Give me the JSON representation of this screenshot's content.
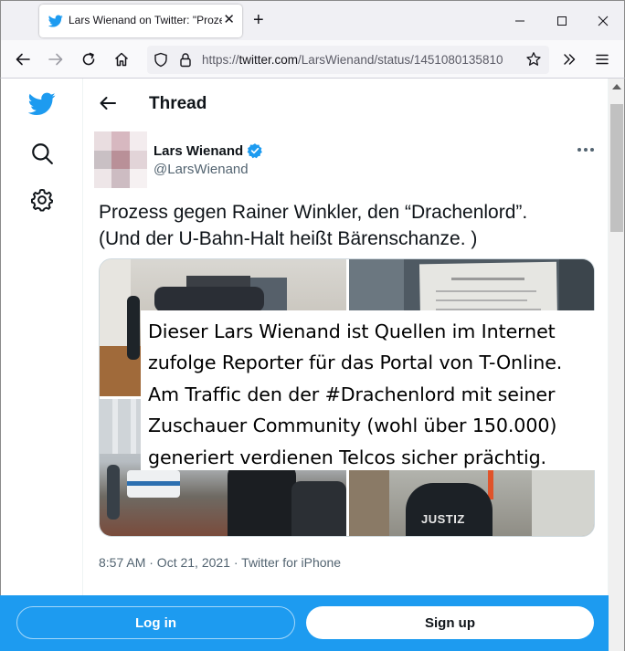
{
  "browser": {
    "tab_title": "Lars Wienand on Twitter: \"Prozess gegen Rainer Winkler, den “Drachenlord”",
    "url_scheme": "https://",
    "url_host": "twitter.com",
    "url_path": "/LarsWienand/status/1451080135810",
    "icons": [
      "twitter-favicon",
      "close-icon",
      "plus-icon",
      "minimize-icon",
      "maximize-icon",
      "close-window-icon",
      "back-arrow-icon",
      "forward-arrow-icon",
      "reload-icon",
      "home-icon",
      "shield-icon",
      "lock-icon",
      "bookmark-star-icon",
      "chevrons-right-icon",
      "hamburger-menu-icon"
    ]
  },
  "sidebar": {
    "icons": [
      "twitter-logo-icon",
      "search-icon",
      "settings-gear-icon"
    ]
  },
  "thread": {
    "title": "Thread"
  },
  "tweet": {
    "author_name": "Lars Wienand",
    "author_handle": "@LarsWienand",
    "verified": true,
    "text_lines": [
      "Prozess gegen Rainer Winkler, den “Drachenlord”.",
      "(Und der U-Bahn-Halt heißt Bärenschanze. )"
    ],
    "photo_labels": {
      "justiz_badge": "JUSTIZ"
    },
    "timestamp": "8:57 AM · Oct 21, 2021 · Twitter for iPhone"
  },
  "overlay_caption": {
    "lines": [
      "Dieser Lars Wienand ist Quellen im Internet",
      "zufolge Reporter für das Portal von T-Online.",
      "Am Traffic den der #Drachenlord mit seiner",
      "Zuschauer Community (wohl über 150.000)",
      "generiert verdienen Telcos sicher prächtig."
    ]
  },
  "bottom_bar": {
    "login_label": "Log in",
    "signup_label": "Sign up"
  },
  "colors": {
    "twitter_blue": "#1d9bf0",
    "text_primary": "#0f1419",
    "text_secondary": "#536471"
  }
}
